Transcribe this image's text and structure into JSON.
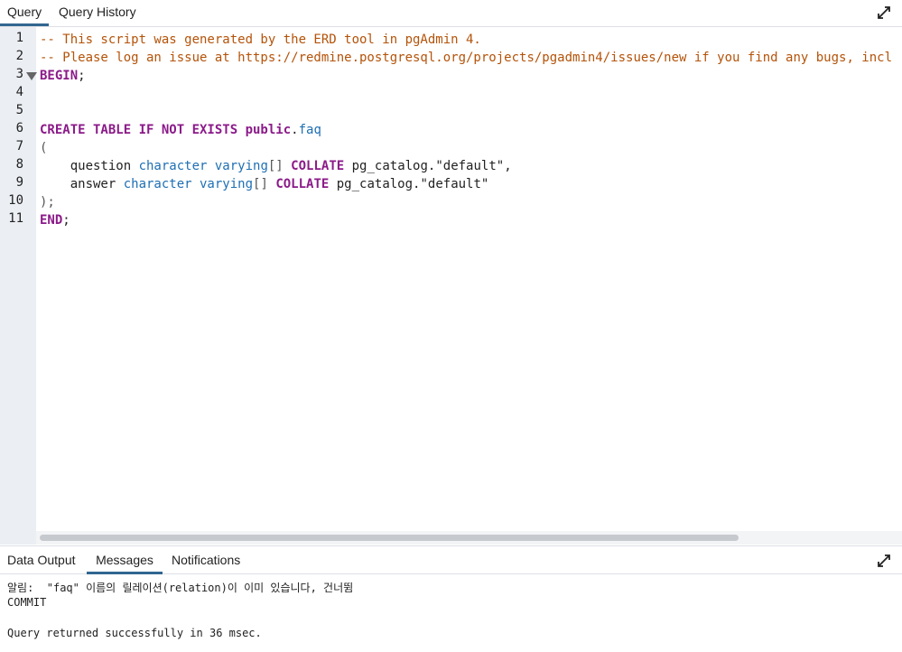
{
  "top_tabs": [
    {
      "label": "Query",
      "active": true
    },
    {
      "label": "Query History",
      "active": false
    }
  ],
  "editor": {
    "line_numbers": [
      "1",
      "2",
      "3",
      "4",
      "5",
      "6",
      "7",
      "8",
      "9",
      "10",
      "11"
    ],
    "lines": {
      "l1": "-- This script was generated by the ERD tool in pgAdmin 4.",
      "l2": "-- Please log an issue at https://redmine.postgresql.org/projects/pgadmin4/issues/new if you find any bugs, incl",
      "l3_kw": "BEGIN",
      "l3_p": ";",
      "l6_kw": "CREATE TABLE IF NOT EXISTS public",
      "l6_p": ".",
      "l6_ty": "faq",
      "l7": "(",
      "l8_a": "    question ",
      "l8_ty": "character varying",
      "l8_b": "[] ",
      "l8_kw": "COLLATE",
      "l8_c": " pg_catalog.\"default\",",
      "l9_a": "    answer ",
      "l9_ty": "character varying",
      "l9_b": "[] ",
      "l9_kw": "COLLATE",
      "l9_c": " pg_catalog.\"default\"",
      "l10": ");",
      "l11_kw": "END",
      "l11_p": ";"
    }
  },
  "bottom_tabs": [
    {
      "label": "Data Output",
      "active": false
    },
    {
      "label": "Messages",
      "active": true
    },
    {
      "label": "Notifications",
      "active": false
    }
  ],
  "messages": {
    "notice": "알림:  \"faq\" 이름의 릴레이션(relation)이 이미 있습니다, 건너뜀",
    "commit": "COMMIT",
    "result": "Query returned successfully in 36 msec."
  },
  "icons": {
    "expand": "expand-icon",
    "fold": "fold-marker-icon"
  }
}
